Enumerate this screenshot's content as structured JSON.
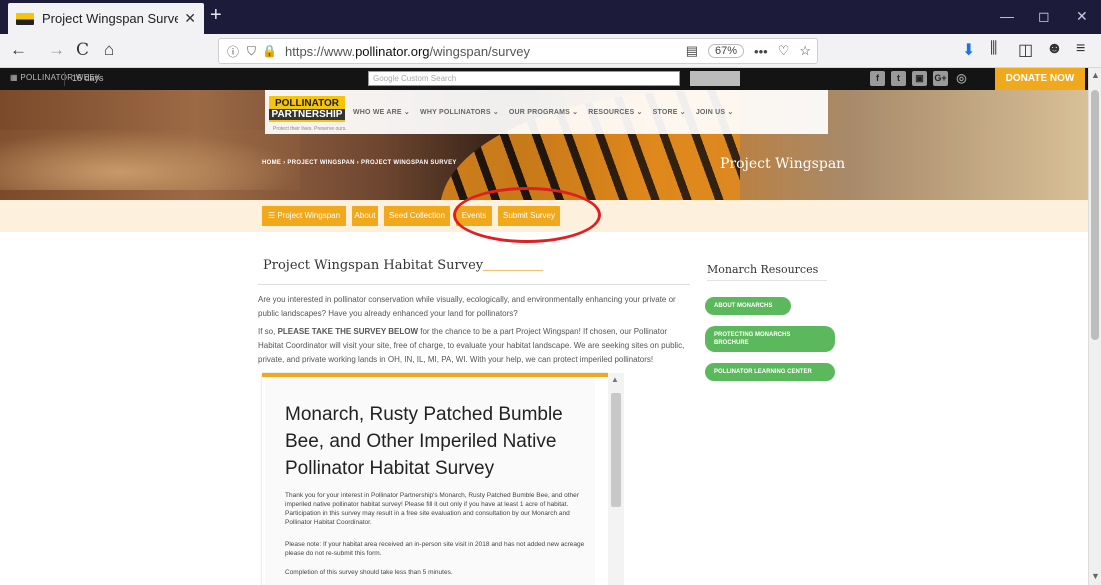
{
  "browser": {
    "tab_title": "Project Wingspan Survey | Polli",
    "tab_close": "✕",
    "new_tab": "+",
    "url_prefix": "https://www.",
    "url_domain": "pollinator.org",
    "url_path": "/wingspan/survey",
    "zoom": "67%",
    "icons": {
      "back": "←",
      "forward": "→",
      "reload": "C",
      "home": "⌂",
      "info": "ⓘ",
      "shield": "⛉",
      "lock": "🔒",
      "reader": "▤",
      "more": "•••",
      "pocket": "♡",
      "bookmark": "☆",
      "download": "⬇",
      "library": "⫼",
      "sidebar": "◫",
      "account": "☻",
      "menu": "≡",
      "minimize": "—",
      "maximize": "◻",
      "close": "✕"
    }
  },
  "site": {
    "topbar": {
      "week_label": "▦ POLLINATOR WEEK",
      "days": "15 days",
      "search_placeholder": "Google Custom Search",
      "social": [
        "f",
        "t",
        "▣",
        "G+",
        "◎"
      ],
      "donate": "DONATE NOW"
    },
    "logo": {
      "line1": "POLLINATOR",
      "line2": "PARTNERSHIP",
      "tagline": "Protect their lives. Preserve ours."
    },
    "menu": [
      "WHO WE ARE ⌄",
      "WHY POLLINATORS ⌄",
      "OUR PROGRAMS ⌄",
      "RESOURCES ⌄",
      "STORE ⌄",
      "JOIN US ⌄"
    ],
    "breadcrumb": "HOME  ›  PROJECT WINGSPAN  ›  PROJECT WINGSPAN SURVEY",
    "hero_title": "Project Wingspan",
    "subnav": [
      "☰ Project Wingspan",
      "About",
      "Seed Collection",
      "Events",
      "Submit Survey"
    ]
  },
  "main": {
    "title": "Project Wingspan Habitat Survey",
    "para1": "Are you interested in pollinator conservation while visually, ecologically, and environmentally enhancing your private or public landscapes? Have you already enhanced your land for pollinators?",
    "para2_lead": "If so, ",
    "para2_bold": "PLEASE TAKE THE SURVEY BELOW",
    "para2_rest": " for the chance to be a part Project Wingspan! If chosen, our Pollinator Habitat Coordinator will visit your site, free of charge, to evaluate your habitat landscape. We are seeking sites on public, private, and private working lands in OH, IN, IL, MI, PA, WI. With your help, we can protect imperiled pollinators!",
    "survey": {
      "title": "Monarch, Rusty Patched Bumble Bee, and Other Imperiled Native Pollinator Habitat Survey",
      "p1": "Thank you for your interest in Pollinator Partnership's Monarch, Rusty Patched Bumble Bee, and other imperiled native pollinator habitat survey! Please fill it out only if you have at least 1 acre of habitat. Participation in this survey may result in a free site evaluation and consultation by our Monarch and Pollinator Habitat Coordinator.",
      "p2": "Please note: If your habitat area received an in-person site visit in 2018 and has not added new acreage please do not re-submit this form.",
      "p3": "Completion of this survey should take less than 5 minutes."
    }
  },
  "aside": {
    "title": "Monarch Resources",
    "buttons": [
      "ABOUT MONARCHS",
      "PROTECTING MONARCHS BROCHURE",
      "POLLINATOR LEARNING CENTER"
    ]
  },
  "colors": {
    "accent": "#f0a81c",
    "green": "#5cb85c",
    "annotation": "#e02020"
  }
}
